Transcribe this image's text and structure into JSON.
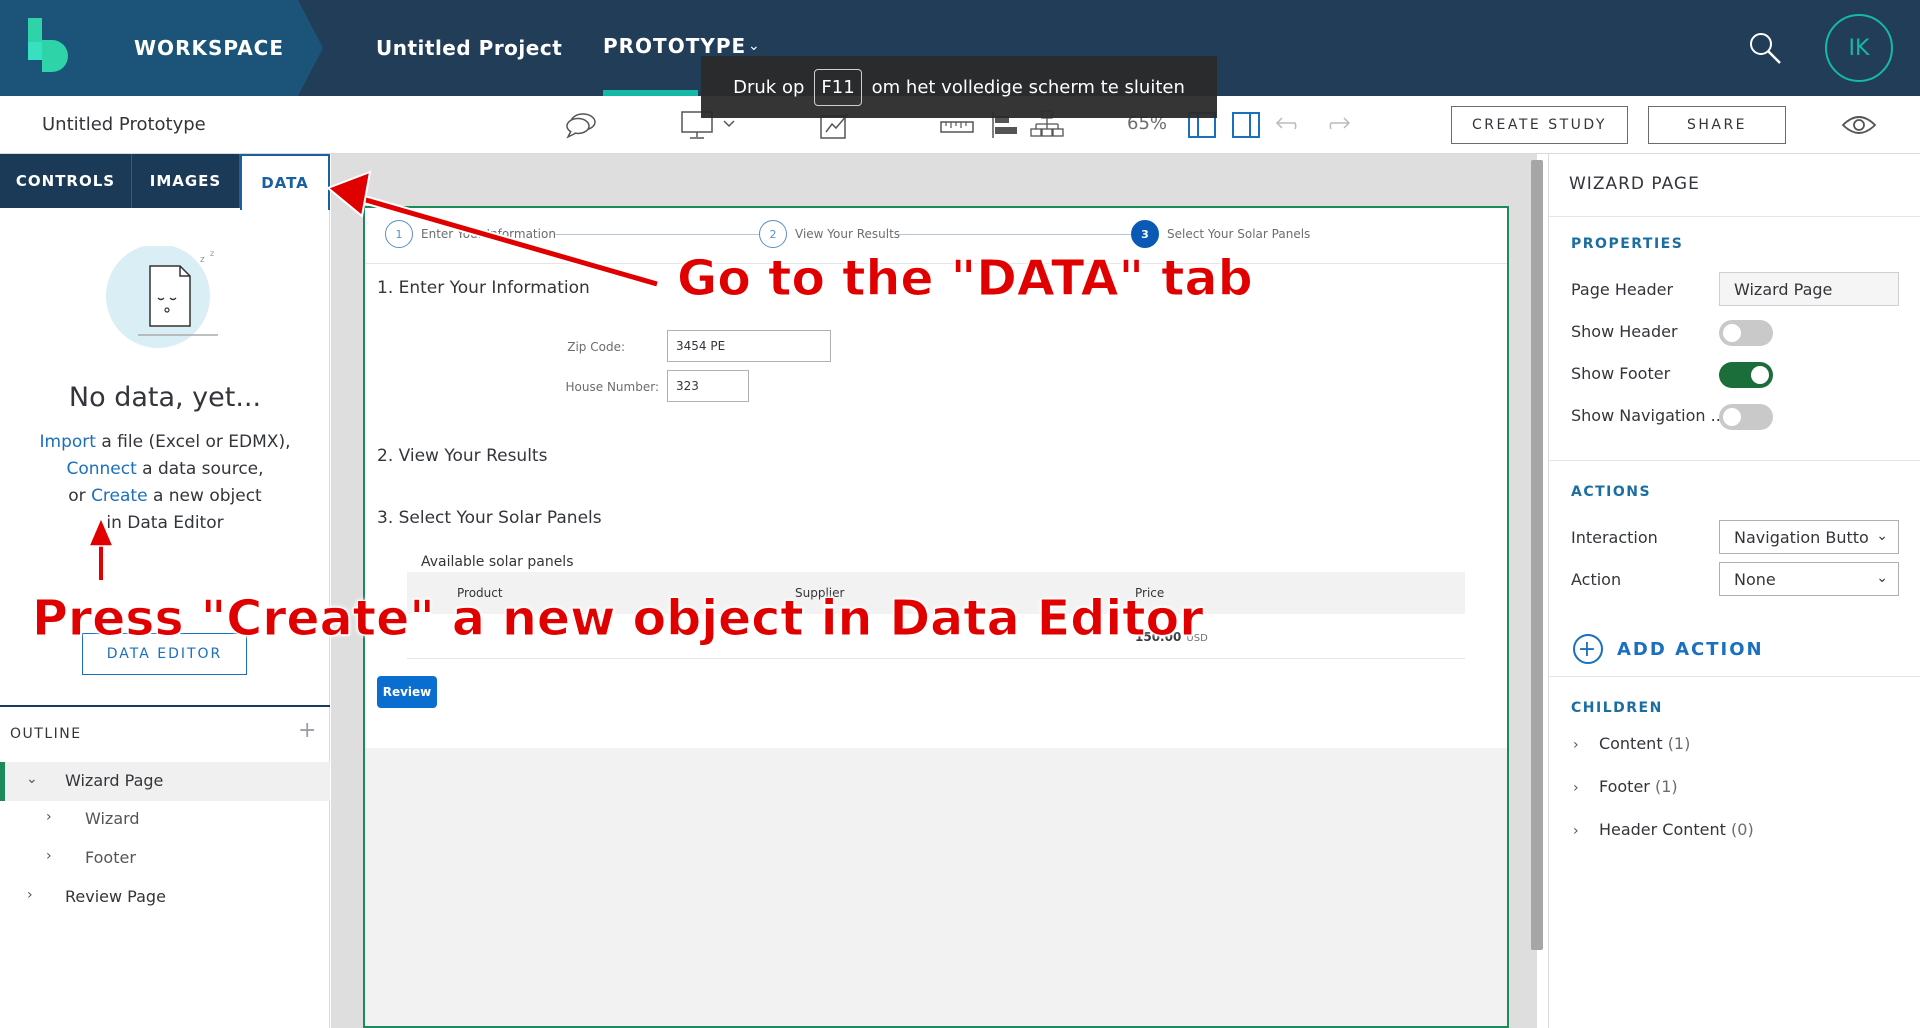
{
  "topbar": {
    "workspace": "WORKSPACE",
    "project": "Untitled Project",
    "prototype": "PROTOTYPE",
    "avatar_initials": "IK",
    "search_icon": "search-icon",
    "accent_color": "#16b8a6"
  },
  "toast": {
    "before": "Druk op",
    "key": "F11",
    "after": "om het volledige scherm te sluiten"
  },
  "toolbar": {
    "prototype_name": "Untitled Prototype",
    "zoom": "65%",
    "create_study": "CREATE STUDY",
    "share": "SHARE",
    "icons": [
      "comment-icon",
      "device-icon",
      "sketch-icon",
      "ruler-icon",
      "align-icon",
      "hierarchy-icon",
      "panel-left-icon",
      "panel-right-icon",
      "undo-icon",
      "redo-icon",
      "eye-icon"
    ]
  },
  "left_panel": {
    "tabs": [
      "CONTROLS",
      "IMAGES",
      "DATA"
    ],
    "active_tab": "DATA",
    "empty_title": "No data, yet...",
    "help": {
      "import": "Import",
      "import_rest": " a file (Excel or EDMX),",
      "connect": "Connect",
      "connect_rest": " a data source,",
      "or": "or ",
      "create": "Create",
      "create_rest": " a new object",
      "line4": "in Data Editor"
    },
    "data_editor_button": "DATA EDITOR",
    "outline": {
      "title": "OUTLINE",
      "items": [
        "Wizard Page",
        "Wizard",
        "Footer",
        "Review Page"
      ]
    }
  },
  "canvas": {
    "steps": [
      {
        "num": "1",
        "label": "Enter Your Information"
      },
      {
        "num": "2",
        "label": "View Your Results"
      },
      {
        "num": "3",
        "label": "Select Your Solar Panels"
      }
    ],
    "sections": [
      "1. Enter Your Information",
      "2. View Your Results",
      "3. Select Your Solar Panels"
    ],
    "zip_label": "Zip Code:",
    "zip_value": "3454 PE",
    "house_label": "House Number:",
    "house_value": "323",
    "panels_title": "Available solar panels",
    "columns": [
      "Product",
      "Supplier",
      "Price"
    ],
    "row": {
      "price": "150.00",
      "currency": "USD"
    },
    "review_button": "Review"
  },
  "right_panel": {
    "title": "WIZARD PAGE",
    "properties_title": "PROPERTIES",
    "page_header_label": "Page Header",
    "page_header_value": "Wizard Page",
    "show_header_label": "Show Header",
    "show_footer_label": "Show Footer",
    "show_navigation_label": "Show Navigation ...",
    "toggles": {
      "show_header": false,
      "show_footer": true,
      "show_navigation": false
    },
    "actions_title": "ACTIONS",
    "interaction_label": "Interaction",
    "interaction_value": "Navigation Butto",
    "action_label": "Action",
    "action_value": "None",
    "add_action": "ADD ACTION",
    "children_title": "CHILDREN",
    "children": [
      {
        "name": "Content",
        "count": "(1)"
      },
      {
        "name": "Footer",
        "count": "(1)"
      },
      {
        "name": "Header Content",
        "count": "(0)"
      }
    ]
  },
  "annotations": {
    "data_tab": "Go to the \"DATA\" tab",
    "create": "Press \"Create\" a new object in Data Editor",
    "color": "#e00000"
  }
}
